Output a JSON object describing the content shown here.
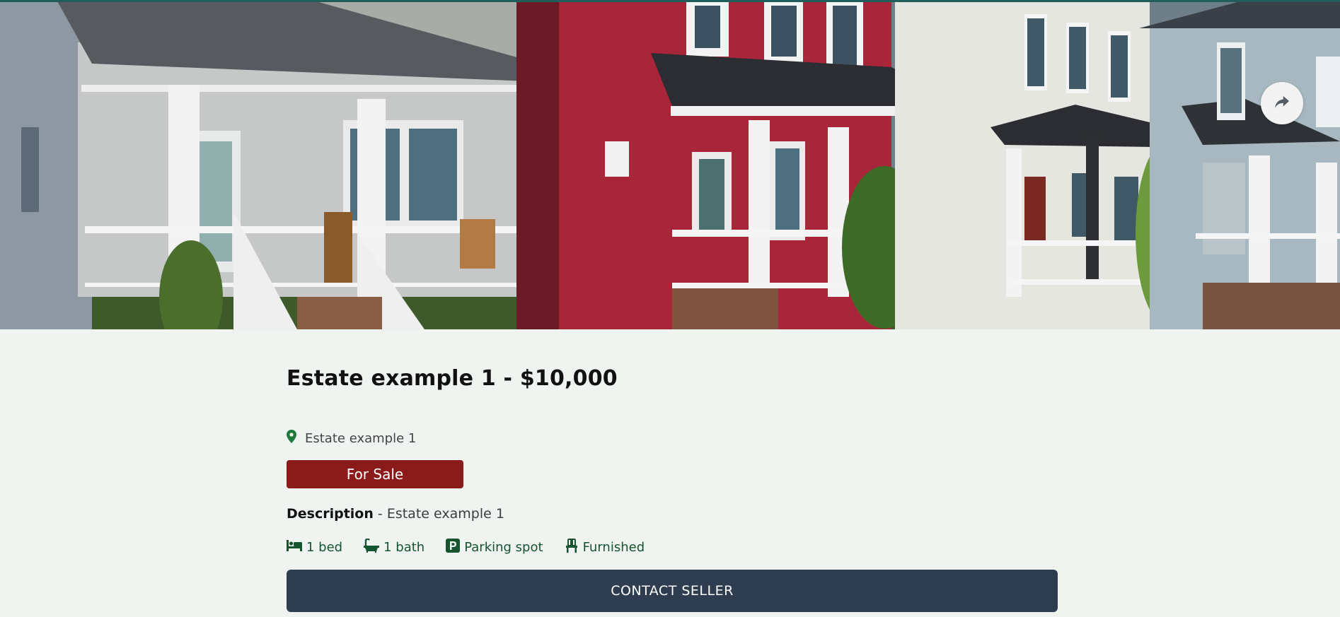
{
  "listing": {
    "title": "Estate example 1 - $10,000",
    "location": "Estate example 1",
    "status": "For Sale",
    "description_label": "Description",
    "description_separator": " - ",
    "description_value": "Estate example 1",
    "features": {
      "bed": "1 bed",
      "bath": "1 bath",
      "parking": "Parking spot",
      "furnished": "Furnished"
    }
  },
  "actions": {
    "contact_label": "CONTACT SELLER",
    "share_icon": "share-arrow-icon"
  },
  "colors": {
    "page_background": "#f0f4f1",
    "status_badge": "#8b1a1a",
    "contact_button": "#2f3d50",
    "feature_text": "#15542e",
    "location_pin": "#1e7a3c",
    "top_strip": "#1f5e5a"
  },
  "icons": {
    "location": "map-pin-icon",
    "bed": "bed-icon",
    "bath": "bath-icon",
    "parking": "parking-icon",
    "furnished": "chair-icon"
  }
}
